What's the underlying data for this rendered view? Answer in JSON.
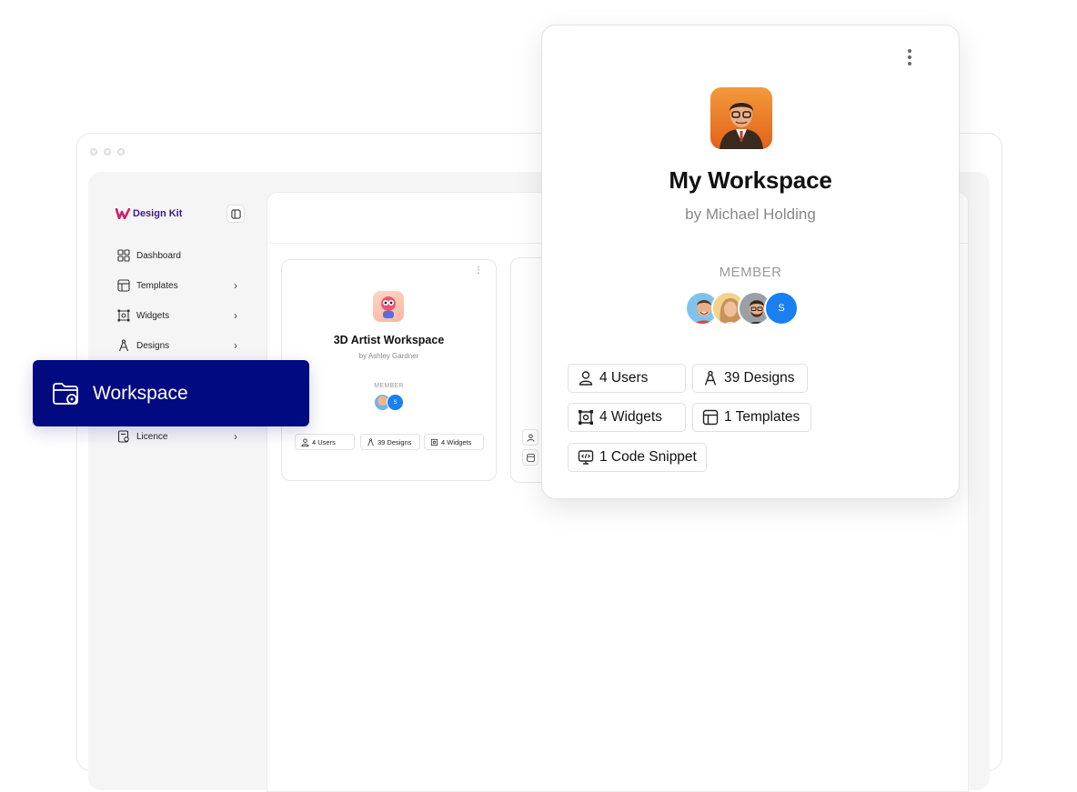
{
  "app": {
    "brand": "Design Kit",
    "nav": [
      {
        "label": "Dashboard",
        "icon": "grid-icon",
        "has_chevron": false
      },
      {
        "label": "Templates",
        "icon": "template-icon",
        "has_chevron": true
      },
      {
        "label": "Widgets",
        "icon": "widget-icon",
        "has_chevron": true
      },
      {
        "label": "Designs",
        "icon": "compass-icon",
        "has_chevron": true
      },
      {
        "label": "Licence",
        "icon": "licence-icon",
        "has_chevron": true
      }
    ],
    "chevron": "›"
  },
  "workspace_highlight": {
    "label": "Workspace",
    "icon": "folder-icon"
  },
  "small_card": {
    "title": "3D Artist Workspace",
    "subtitle": "by Ashley Gardner",
    "member_label": "MEMBER",
    "member_initial": "S",
    "chips": [
      "4 Users",
      "39 Designs",
      "4 Widgets"
    ]
  },
  "big_card": {
    "title": "My Workspace",
    "subtitle": "by Michael Holding",
    "member_label": "MEMBER",
    "member_initial": "S",
    "chips": [
      "4 Users",
      "39 Designs",
      "4 Widgets",
      "1 Templates",
      "1 Code Snippet"
    ]
  },
  "colors": {
    "accent": "#020a82",
    "brand": "#3b1a8f",
    "avatar_blue": "#1a7ff0"
  }
}
